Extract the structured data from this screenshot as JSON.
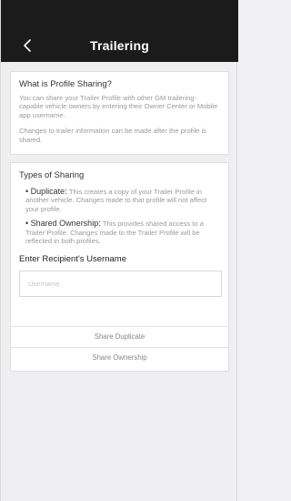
{
  "header": {
    "title": "Trailering",
    "back_icon": "chevron-left-icon"
  },
  "profile_sharing": {
    "heading": "What is Profile Sharing?",
    "paragraph1": "You can share your Trailer Profile with other GM trailering-capable vehicle owners by entering their Owner Center or Mobile app username.",
    "paragraph2": "Changes to trailer information can be made after the profile is shared."
  },
  "sharing_types": {
    "heading": "Types of Sharing",
    "duplicate_title": "Duplicate:",
    "duplicate_desc": "This creates a copy of your Trailer Profile in another vehicle. Changes made to that profile will not affect your profile.",
    "shared_title": "Shared Ownership:",
    "shared_desc": "This provides shared access to a Trailer Profile. Changes made to the Trailer Profile will be reflected in both profiles."
  },
  "recipient": {
    "label": "Enter Recipient's Username",
    "placeholder": "Username",
    "value": ""
  },
  "actions": {
    "share_duplicate": "Share Duplicate",
    "share_ownership": "Share Ownership"
  },
  "colors": {
    "header_bg": "#1b1b1b",
    "page_bg": "#efeff1",
    "card_bg": "#ffffff",
    "muted_text": "#9a9a9a"
  }
}
